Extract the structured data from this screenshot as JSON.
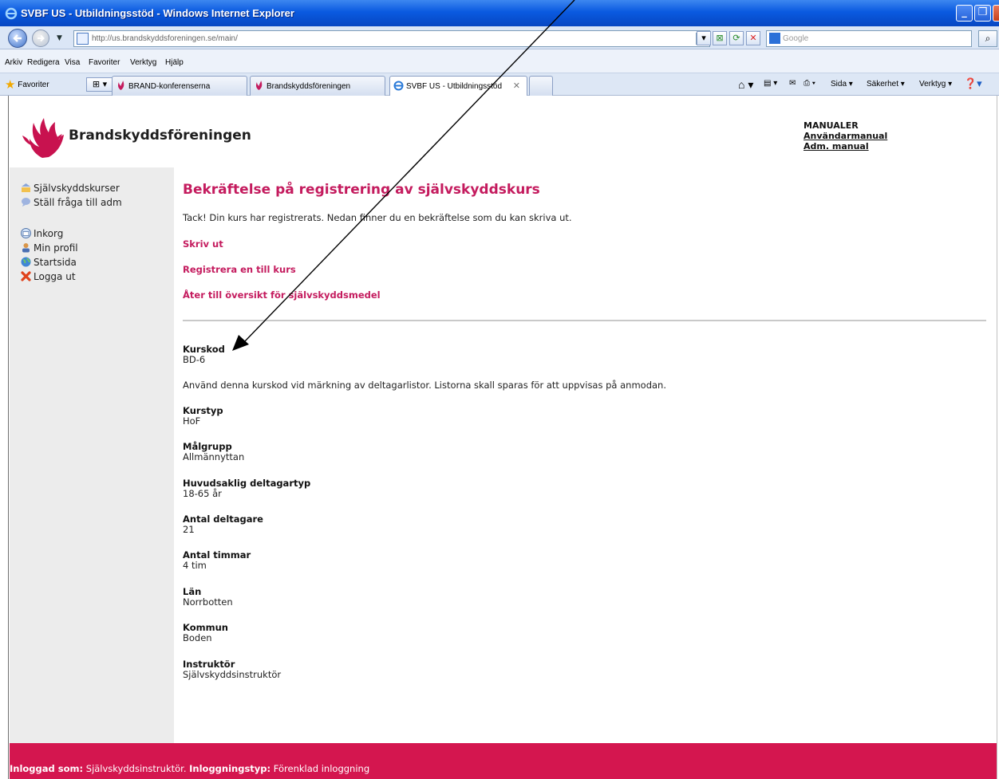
{
  "window": {
    "title": "SVBF US - Utbildningsstöd - Windows Internet Explorer",
    "url": "http://us.brandskyddsforeningen.se/main/",
    "search_placeholder": "Google"
  },
  "menu": [
    "Arkiv",
    "Redigera",
    "Visa",
    "Favoriter",
    "Verktyg",
    "Hjälp"
  ],
  "favorites_bar": {
    "favorites_label": "Favoriter",
    "tabs": [
      {
        "label": "BRAND-konferenserna",
        "active": false
      },
      {
        "label": "Brandskyddsföreningen",
        "active": false
      },
      {
        "label": "SVBF US - Utbildningsstöd",
        "active": true
      }
    ],
    "tools": {
      "page": "Sida",
      "security": "Säkerhet",
      "tools": "Verktyg"
    }
  },
  "header": {
    "brand": "Brandskyddsföreningen",
    "manuals_heading": "MANUALER",
    "manual_user": "Användarmanual",
    "manual_admin": "Adm. manual"
  },
  "sidebar": {
    "items": [
      {
        "label": "Självskyddskurser",
        "icon": "course-icon"
      },
      {
        "label": "Ställ fråga till adm",
        "icon": "question-bubble-icon"
      },
      {
        "label": "Inkorg",
        "icon": "inbox-icon"
      },
      {
        "label": "Min profil",
        "icon": "user-icon"
      },
      {
        "label": "Startsida",
        "icon": "globe-icon"
      },
      {
        "label": "Logga ut",
        "icon": "logout-x-icon"
      }
    ]
  },
  "main": {
    "title": "Bekräftelse på registrering av självskyddskurs",
    "intro": "Tack! Din kurs har registrerats. Nedan finner du en bekräftelse som du kan skriva ut.",
    "links": {
      "print": "Skriv ut",
      "register_another": "Registrera en till kurs",
      "back": "Åter till översikt för självskyddsmedel"
    },
    "course_code_label": "Kurskod",
    "course_code_value": "BD-6",
    "course_code_note": "Använd denna kurskod vid märkning av deltagarlistor. Listorna skall sparas för att uppvisas på anmodan.",
    "fields": [
      {
        "label": "Kurstyp",
        "value": "HoF"
      },
      {
        "label": "Målgrupp",
        "value": "Allmännyttan"
      },
      {
        "label": "Huvudsaklig deltagartyp",
        "value": "18-65 år"
      },
      {
        "label": "Antal deltagare",
        "value": "21"
      },
      {
        "label": "Antal timmar",
        "value": "4 tim"
      },
      {
        "label": "Län",
        "value": "Norrbotten"
      },
      {
        "label": "Kommun",
        "value": "Boden"
      },
      {
        "label": "Instruktör",
        "value": "Självskyddsinstruktör"
      }
    ]
  },
  "footer": {
    "logged_in_label": "Inloggad som:",
    "logged_in_value": "Självskyddsinstruktör.",
    "login_type_label": "Inloggningstyp:",
    "login_type_value": "Förenklad inloggning"
  },
  "colors": {
    "accent": "#c41b5e",
    "footer": "#d4164f",
    "sidebar": "#ececec"
  }
}
